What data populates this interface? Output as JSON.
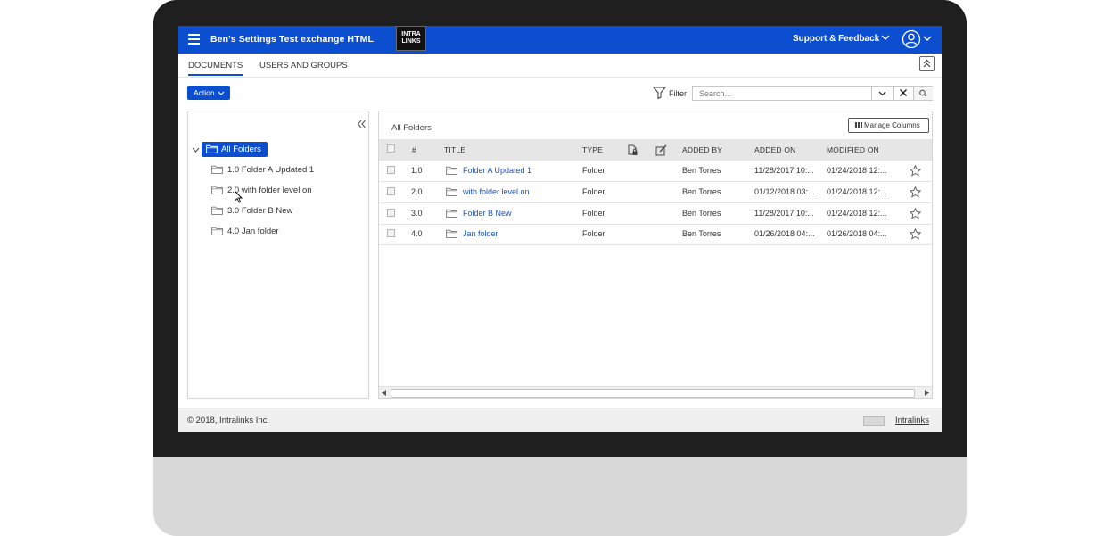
{
  "app": {
    "title": "Ben's Settings Test exchange HTML",
    "logo_line1": "INTRA",
    "logo_line2": "LINKS",
    "support_label": "Support & Feedback",
    "accent_color": "#0b4fd0"
  },
  "tabs": [
    {
      "label": "DOCUMENTS",
      "active": true
    },
    {
      "label": "USERS AND GROUPS",
      "active": false
    }
  ],
  "toolbar": {
    "action_label": "Action",
    "filter_label": "Filter",
    "search_placeholder": "Search..."
  },
  "tree": {
    "root_label": "All Folders",
    "items": [
      {
        "label": "1.0 Folder A Updated 1"
      },
      {
        "label": "2.0 with folder level on"
      },
      {
        "label": "3.0 Folder B New"
      },
      {
        "label": "4.0 Jan folder"
      }
    ]
  },
  "grid": {
    "breadcrumb": "All Folders",
    "manage_columns_label": "Manage Columns",
    "columns": {
      "number": "#",
      "title": "TITLE",
      "type": "TYPE",
      "added_by": "ADDED BY",
      "added_on": "ADDED ON",
      "modified_on": "MODIFIED ON"
    },
    "rows": [
      {
        "number": "1.0",
        "title": "Folder A Updated 1",
        "type": "Folder",
        "added_by": "Ben Torres",
        "added_on": "11/28/2017 10:...",
        "modified_on": "01/24/2018 12:..."
      },
      {
        "number": "2.0",
        "title": "with folder level on",
        "type": "Folder",
        "added_by": "Ben Torres",
        "added_on": "01/12/2018 03:...",
        "modified_on": "01/24/2018 12:..."
      },
      {
        "number": "3.0",
        "title": "Folder B New",
        "type": "Folder",
        "added_by": "Ben Torres",
        "added_on": "11/28/2017 10:...",
        "modified_on": "01/24/2018 12:..."
      },
      {
        "number": "4.0",
        "title": "Jan folder",
        "type": "Folder",
        "added_by": "Ben Torres",
        "added_on": "01/26/2018 04:...",
        "modified_on": "01/26/2018 04:..."
      }
    ]
  },
  "footer": {
    "copyright": "© 2018, Intralinks Inc.",
    "link_label": "Intralinks"
  }
}
